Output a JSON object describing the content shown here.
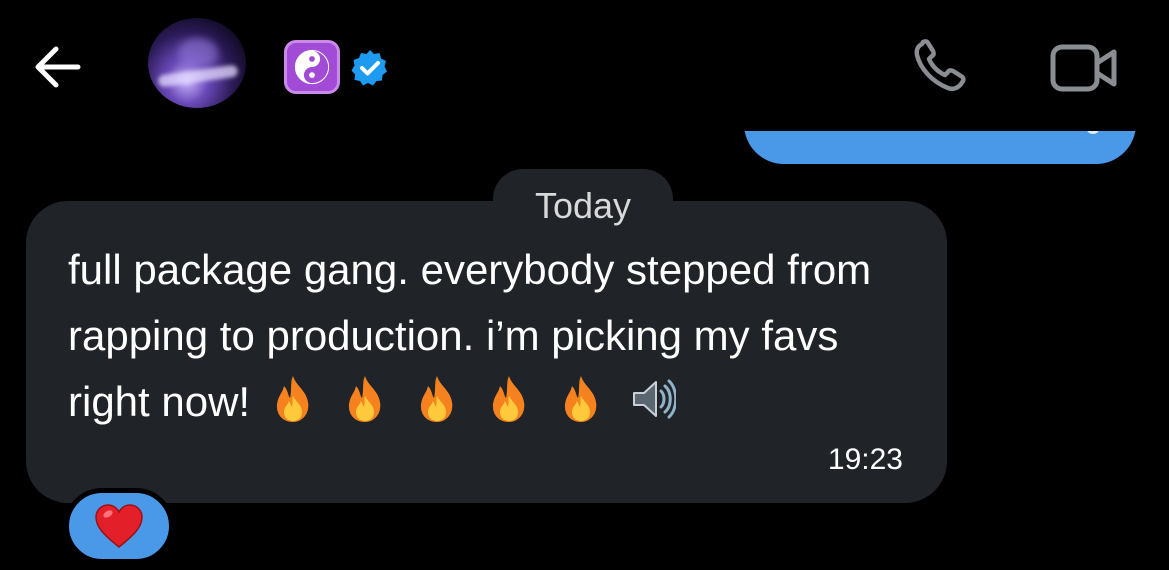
{
  "header": {
    "back_icon": "arrow-left-icon",
    "avatar_alt": "contact-avatar",
    "badge_icon": "yin-yang-icon",
    "verified_icon": "verified-badge-icon",
    "call_icon": "phone-icon",
    "video_icon": "video-camera-icon"
  },
  "conversation": {
    "date_separator": "Today",
    "messages": [
      {
        "direction": "incoming",
        "text": "full package gang. everybody stepped from rapping to production. i’m picking my favs right now!",
        "emojis": [
          "fire-emoji",
          "fire-emoji",
          "fire-emoji",
          "fire-emoji",
          "fire-emoji",
          "speaker-emoji"
        ],
        "time": "19:23",
        "reaction": "red-heart-emoji"
      }
    ]
  },
  "colors": {
    "background": "#000000",
    "bubble_incoming": "#202327",
    "bubble_outgoing": "#4a99e9",
    "accent": "#1d9bf0",
    "badge_purple": "#a24bd6"
  }
}
